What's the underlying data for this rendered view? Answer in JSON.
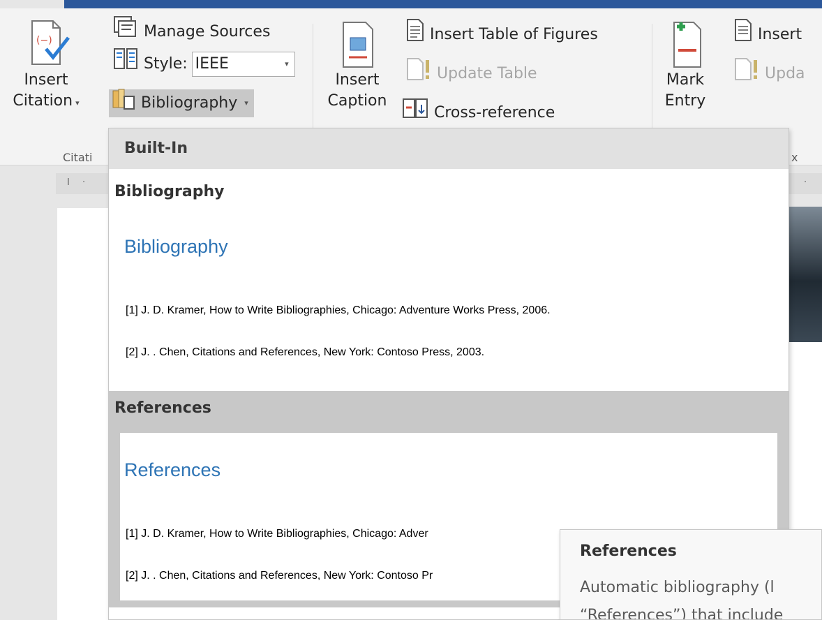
{
  "ribbon": {
    "insert_citation_line1": "Insert",
    "insert_citation_line2": "Citation",
    "manage_sources": "Manage Sources",
    "style_label": "Style:",
    "style_value": "IEEE",
    "bibliography": "Bibliography",
    "group_citations": "Citati",
    "insert_caption_line1": "Insert",
    "insert_caption_line2": "Caption",
    "insert_table_of_figures": "Insert Table of Figures",
    "update_table": "Update Table",
    "cross_reference": "Cross-reference",
    "mark_entry_line1": "Mark",
    "mark_entry_line2": "Entry",
    "insert_index_partial": "Insert",
    "update_index_partial": "Upda",
    "group_index_partial": "x"
  },
  "menu": {
    "header": "Built-In",
    "items": [
      {
        "title": "Bibliography",
        "preview_heading": "Bibliography",
        "entries": [
          "[1] J. D. Kramer, How to Write Bibliographies, Chicago: Adventure Works Press, 2006.",
          "[2] J. . Chen, Citations and References, New York: Contoso Press, 2003."
        ]
      },
      {
        "title": "References",
        "preview_heading": "References",
        "entries": [
          "[1] J. D. Kramer, How to Write Bibliographies, Chicago: Adver",
          "[2] J. . Chen, Citations and References, New York: Contoso Pr"
        ]
      }
    ]
  },
  "tooltip": {
    "title": "References",
    "line1": "Automatic bibliography (l",
    "line2": "“References”) that include"
  },
  "ruler": {
    "marks": [
      "I",
      "·",
      "·"
    ]
  },
  "colors": {
    "accent": "#2b579a",
    "heading_blue": "#2e74b5",
    "hover": "#c8c8c8"
  }
}
